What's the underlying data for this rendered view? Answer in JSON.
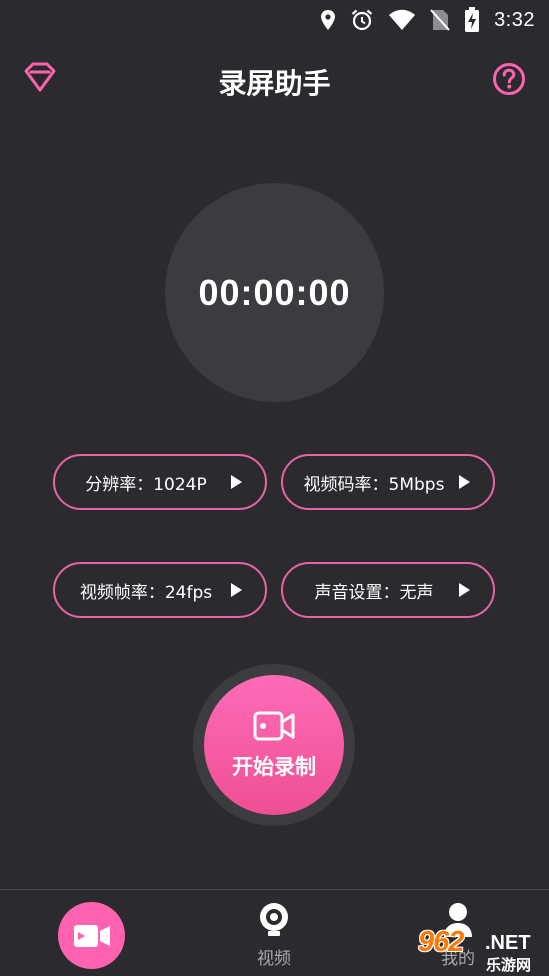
{
  "status_bar": {
    "time": "3:32",
    "icons": [
      "location-icon",
      "alarm-icon",
      "wifi-icon",
      "no-sim-icon",
      "battery-charging-icon"
    ]
  },
  "header": {
    "title": "录屏助手",
    "left_icon": "diamond-vip-icon",
    "right_icon": "help-icon"
  },
  "timer": {
    "value": "00:00:00"
  },
  "settings": {
    "resolution": "分辨率：1024P",
    "bitrate": "视频码率：5Mbps",
    "framerate": "视频帧率：24fps",
    "audio": "声音设置：无声"
  },
  "record_button": {
    "label": "开始录制",
    "icon": "video-camera-icon"
  },
  "bottom_nav": {
    "items": [
      {
        "icon": "record-video-icon",
        "label": ""
      },
      {
        "icon": "webcam-icon",
        "label": "视频"
      },
      {
        "icon": "user-icon",
        "label": "我的"
      }
    ]
  },
  "watermark": {
    "logo": "962",
    "suffix": ".NET",
    "sub": "乐游网"
  },
  "colors": {
    "background": "#2b2a2e",
    "accent": "#ff62b0",
    "pill_border": "#e765a6",
    "circle": "#3c3b40"
  }
}
